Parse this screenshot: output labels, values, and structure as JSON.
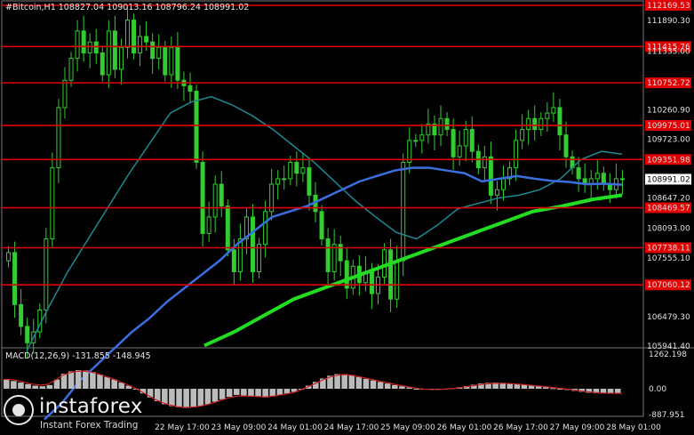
{
  "header": {
    "symbol_line": "#Bitcoin,H1  108827.04 109013.16 108796.24 108991.02"
  },
  "macd": {
    "label": "MACD(12,26,9) -131.855 -148.945",
    "y_labels": [
      "1262.198",
      "0.00",
      "-887.951"
    ]
  },
  "logo": {
    "name": "instaforex",
    "tagline": "Instant Forex Trading"
  },
  "colors": {
    "background": "#000000",
    "candle": "#33cc33",
    "level_line": "#e00000",
    "ma_fast": "#3b6fe0",
    "ma_mid": "#1d8a93",
    "ma_slow": "#22dd22",
    "macd_hist": "#bbbbbb",
    "macd_signal": "#cc2222"
  },
  "chart_data": {
    "type": "candlestick",
    "ylim": [
      105941.4,
      112169.53
    ],
    "price_labels": [
      "112169.53",
      "111890.30",
      "111415.76",
      "111335.00",
      "110752.72",
      "110260.90",
      "109975.01",
      "109723.00",
      "109351.98",
      "108991.02",
      "108647.20",
      "108469.57",
      "108093.00",
      "107738.11",
      "107555.10",
      "107060.12",
      "106479.30",
      "105941.40"
    ],
    "current_price": "108991.02",
    "levels": [
      112169.53,
      111415.76,
      110752.72,
      109975.01,
      109351.98,
      108469.57,
      107738.11,
      107060.12
    ],
    "x_ticks": [
      "22 May 17:00",
      "23 May 09:00",
      "24 May 01:00",
      "24 May 17:00",
      "25 May 09:00",
      "26 May 01:00",
      "26 May 17:00",
      "27 May 09:00",
      "28 May 01:00"
    ],
    "close": [
      107650,
      106700,
      106300,
      106000,
      106200,
      106600,
      107900,
      109200,
      110300,
      110800,
      111200,
      111700,
      111300,
      111500,
      111300,
      110900,
      111700,
      111000,
      111400,
      111900,
      111300,
      111600,
      111500,
      111200,
      111400,
      110900,
      111400,
      110800,
      110700,
      110600,
      109300,
      108000,
      108300,
      108900,
      108500,
      107700,
      107300,
      107900,
      108300,
      107300,
      107800,
      108400,
      108900,
      109000,
      109000,
      109300,
      109100,
      109200,
      108700,
      108400,
      107900,
      107300,
      107800,
      107500,
      107000,
      107400,
      107100,
      107300,
      106900,
      107200,
      107700,
      106800,
      107500,
      109300,
      109700,
      109700,
      109800,
      110000,
      109800,
      110100,
      109900,
      109400,
      109600,
      109900,
      109500,
      109200,
      109400,
      108700,
      108800,
      109000,
      109200,
      109700,
      109900,
      110100,
      109900,
      110100,
      110200,
      110300,
      109800,
      109400,
      109200,
      109000,
      108900,
      109000,
      109100,
      108900,
      108800,
      109000,
      108991
    ],
    "ma_fast": [
      104600,
      104900,
      105300,
      105600,
      105900,
      106200,
      106450,
      106750,
      107000,
      107250,
      107500,
      107800,
      108050,
      108300,
      108400,
      108500,
      108650,
      108800,
      108950,
      109050,
      109150,
      109200,
      109200,
      109150,
      109100,
      108950,
      109000,
      109050,
      109000,
      108960,
      108940,
      108900,
      108910,
      108891
    ],
    "ma_mid": [
      105850,
      106600,
      107300,
      107900,
      108500,
      109100,
      109650,
      110200,
      110400,
      110500,
      110350,
      110150,
      109900,
      109600,
      109300,
      108950,
      108600,
      108300,
      108020,
      107900,
      108150,
      108450,
      108550,
      108650,
      108700,
      108800,
      109000,
      109350,
      109500,
      109450
    ],
    "ma_slow": [
      105950,
      106200,
      106500,
      106800,
      107000,
      107200,
      107400,
      107600,
      107800,
      108000,
      108200,
      108400,
      108500,
      108620,
      108700
    ],
    "macd_hist": [
      300,
      250,
      200,
      150,
      100,
      80,
      120,
      300,
      480,
      560,
      600,
      590,
      540,
      460,
      380,
      300,
      200,
      100,
      0,
      -150,
      -280,
      -400,
      -500,
      -560,
      -600,
      -620,
      -600,
      -560,
      -500,
      -420,
      -340,
      -260,
      -200,
      -220,
      -240,
      -260,
      -280,
      -250,
      -200,
      -150,
      -100,
      0,
      100,
      220,
      330,
      420,
      470,
      470,
      430,
      380,
      320,
      270,
      220,
      170,
      120,
      80,
      40,
      0,
      -20,
      -30,
      -20,
      0,
      20,
      50,
      90,
      130,
      170,
      190,
      200,
      190,
      170,
      150,
      130,
      100,
      80,
      50,
      20,
      -10,
      -40,
      -70,
      -100,
      -130,
      -145,
      -140,
      -135,
      -132
    ],
    "macd_signal": [
      300,
      300,
      260,
      200,
      150,
      120,
      140,
      260,
      420,
      510,
      560,
      570,
      540,
      480,
      400,
      320,
      230,
      130,
      30,
      -100,
      -230,
      -360,
      -460,
      -530,
      -580,
      -600,
      -590,
      -560,
      -510,
      -440,
      -360,
      -290,
      -240,
      -230,
      -240,
      -250,
      -260,
      -240,
      -200,
      -160,
      -110,
      -20,
      80,
      190,
      300,
      390,
      440,
      460,
      430,
      380,
      330,
      280,
      230,
      180,
      130,
      90,
      50,
      10,
      -15,
      -25,
      -20,
      -5,
      15,
      45,
      80,
      115,
      150,
      170,
      180,
      175,
      160,
      145,
      125,
      100,
      80,
      55,
      25,
      0,
      -30,
      -60,
      -90,
      -115,
      -135,
      -145,
      -148,
      -149
    ]
  }
}
